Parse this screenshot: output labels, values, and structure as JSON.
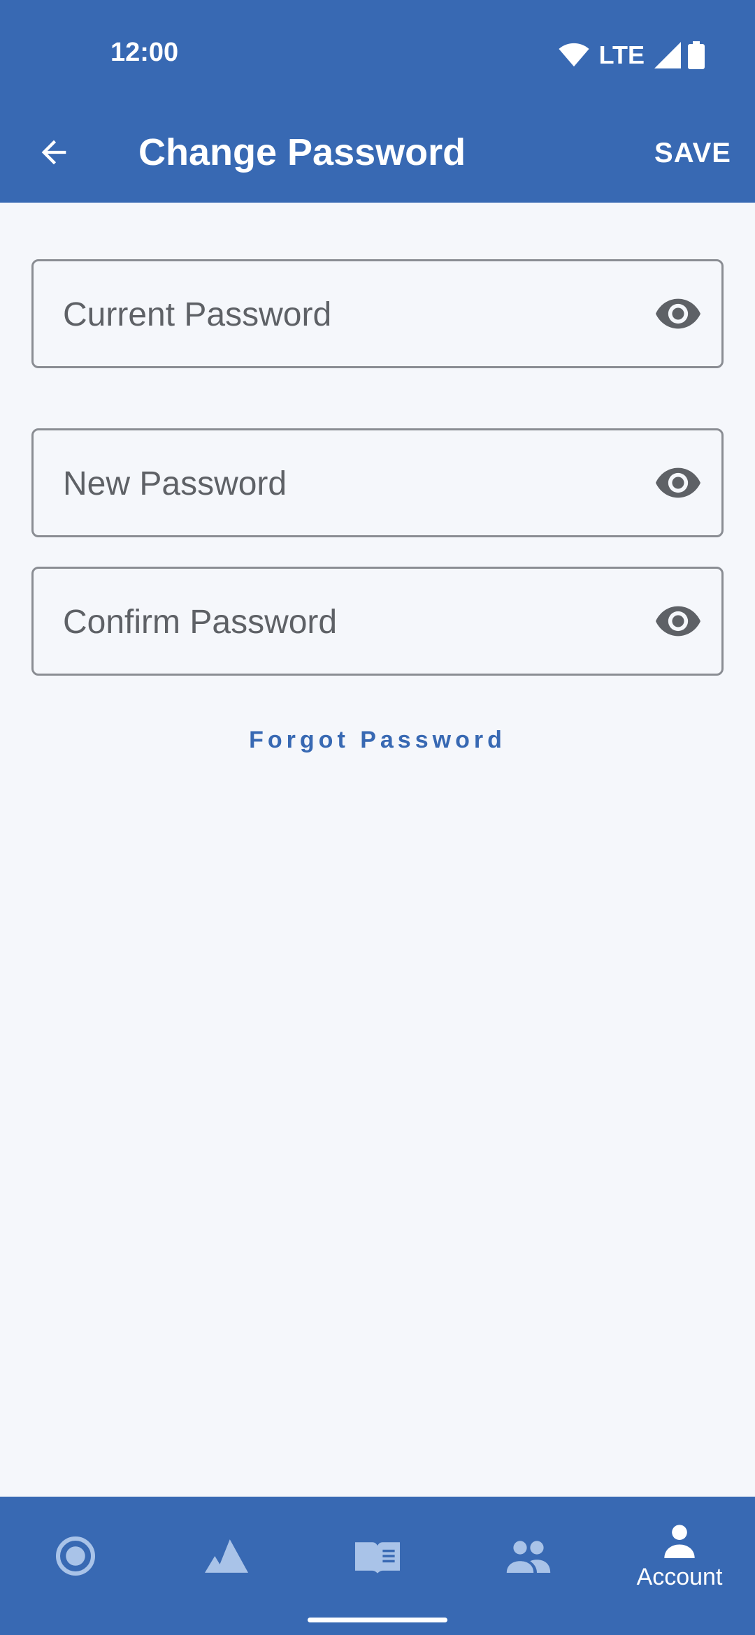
{
  "status_bar": {
    "time": "12:00",
    "network": "LTE"
  },
  "app_bar": {
    "title": "Change Password",
    "save_label": "SAVE"
  },
  "form": {
    "current_placeholder": "Current Password",
    "new_placeholder": "New Password",
    "confirm_placeholder": "Confirm Password",
    "current_value": "",
    "new_value": "",
    "confirm_value": ""
  },
  "forgot_label": "Forgot Password",
  "bottom_nav": {
    "items": [
      {
        "icon": "record-circle-icon",
        "label": ""
      },
      {
        "icon": "mountain-icon",
        "label": ""
      },
      {
        "icon": "book-icon",
        "label": ""
      },
      {
        "icon": "group-icon",
        "label": ""
      },
      {
        "icon": "person-icon",
        "label": "Account"
      }
    ],
    "active_index": 4
  },
  "colors": {
    "primary": "#3869B3",
    "background": "#F5F7FB",
    "inactive_icon": "#A9C3E8"
  }
}
